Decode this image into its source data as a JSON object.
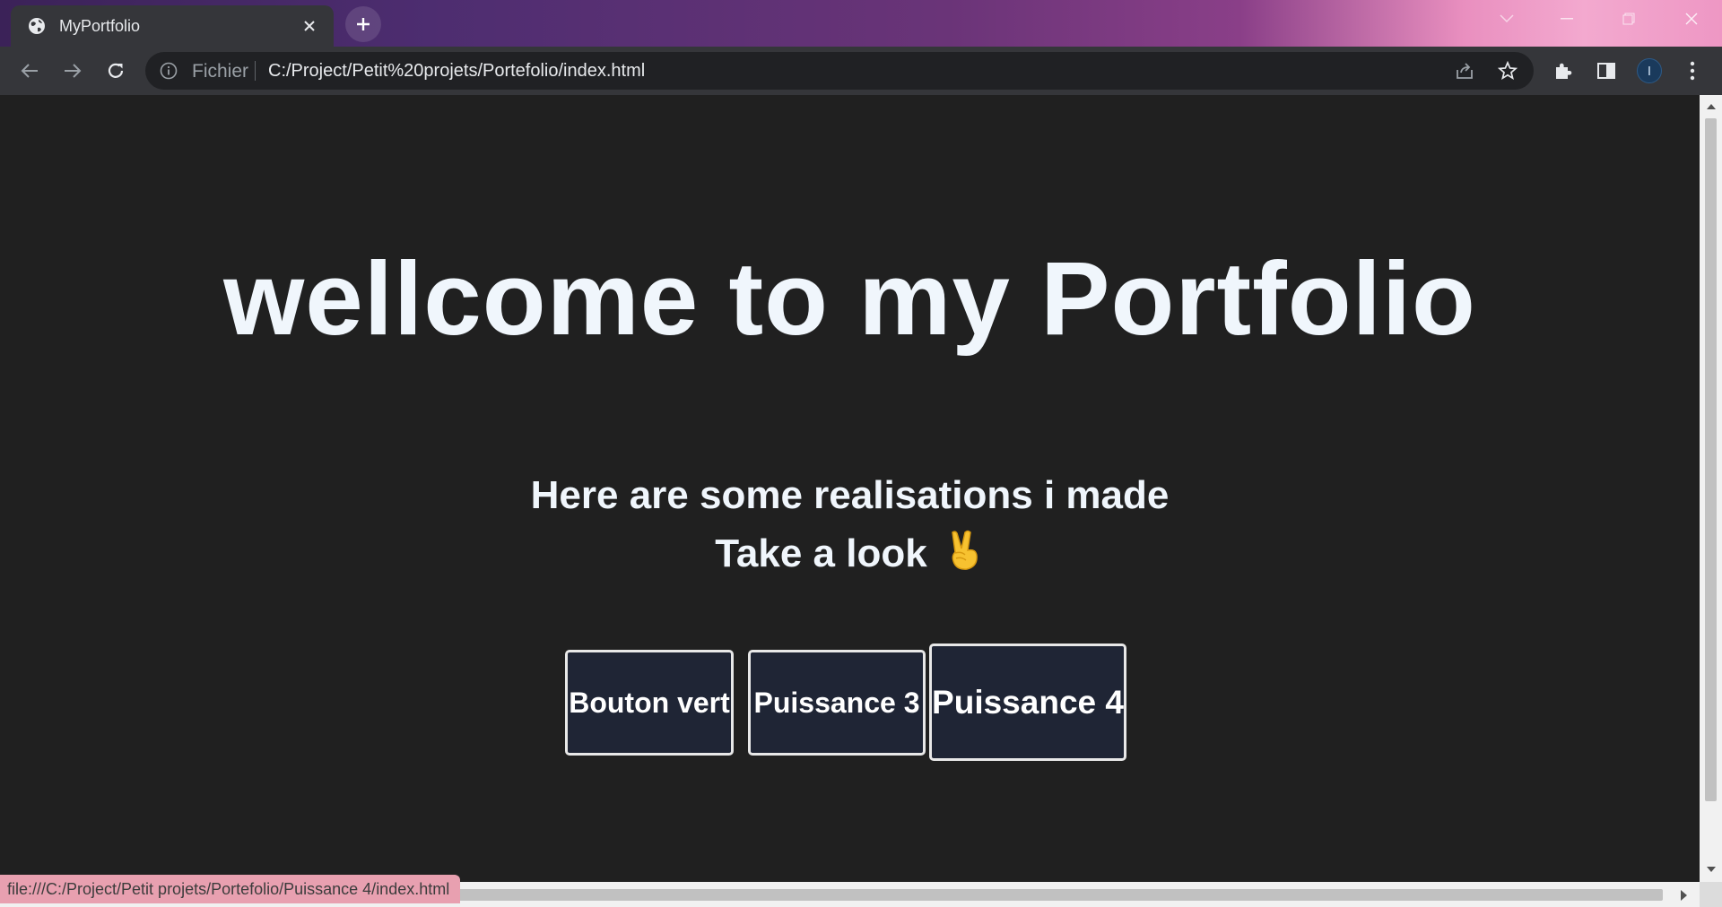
{
  "browser": {
    "tab": {
      "title": "MyPortfolio",
      "favicon": "globe-icon"
    },
    "omnibox": {
      "security_label": "Fichier",
      "url": "C:/Project/Petit%20projets/Portefolio/index.html"
    },
    "profile_initial": "I",
    "status_url": "file:///C:/Project/Petit projets/Portefolio/Puissance 4/index.html"
  },
  "page": {
    "title": "wellcome to my Portfolio",
    "subtitle_line1": "Here are some realisations i made",
    "subtitle_line2": "Take a look",
    "emoji": "✌️",
    "projects": [
      {
        "label": "Bouton vert"
      },
      {
        "label": "Puissance 3"
      },
      {
        "label": "Puissance 4"
      }
    ]
  },
  "colors": {
    "page_background": "#202020",
    "text": "#f0f6fc",
    "button_background": "#1f2535",
    "button_border": "#e8e8e8"
  }
}
